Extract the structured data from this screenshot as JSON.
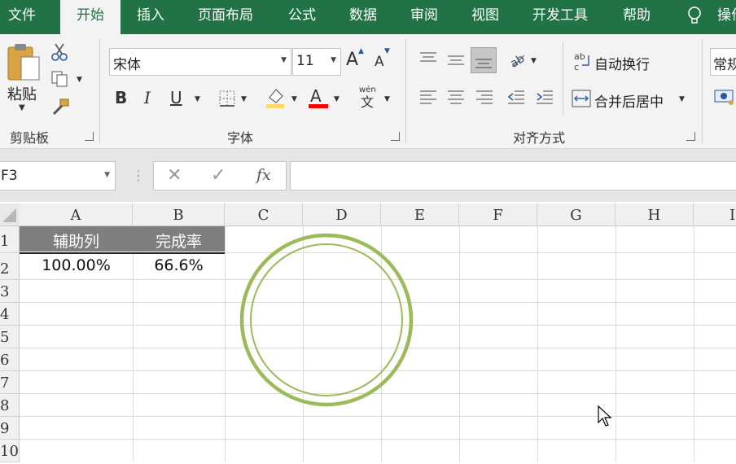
{
  "tabs": [
    {
      "label": "文件"
    },
    {
      "label": "开始"
    },
    {
      "label": "插入"
    },
    {
      "label": "页面布局"
    },
    {
      "label": "公式"
    },
    {
      "label": "数据"
    },
    {
      "label": "审阅"
    },
    {
      "label": "视图"
    },
    {
      "label": "开发工具"
    },
    {
      "label": "帮助"
    },
    {
      "label": "操作"
    }
  ],
  "ribbon": {
    "clipboard": {
      "paste_label": "粘贴",
      "group_label": "剪贴板"
    },
    "font": {
      "font_name": "宋体",
      "font_size": "11",
      "group_label": "字体",
      "grow_label": "A",
      "shrink_label": "A",
      "bold": "B",
      "italic": "I",
      "underline": "U",
      "font_color_label": "A",
      "phonetic_top": "wén",
      "phonetic_bottom": "文"
    },
    "alignment": {
      "wrap_label": "自动换行",
      "merge_label": "合并后居中",
      "group_label": "对齐方式"
    },
    "number": {
      "format": "常规"
    }
  },
  "formula_bar": {
    "name_box": "F3",
    "fx": "fx",
    "value": ""
  },
  "columns": [
    "A",
    "B",
    "C",
    "D",
    "E",
    "F",
    "G",
    "H",
    "I"
  ],
  "rows": [
    "1",
    "2",
    "3",
    "4",
    "5",
    "6",
    "7",
    "8",
    "9",
    "10"
  ],
  "cells": {
    "A1": "辅助列",
    "B1": "完成率",
    "A2": "100.00%",
    "B2": "66.6%"
  },
  "colors": {
    "accent": "#217346",
    "header_fill": "#7f7f7f",
    "ring": "#9bbb59",
    "font_red": "#ff0000"
  }
}
